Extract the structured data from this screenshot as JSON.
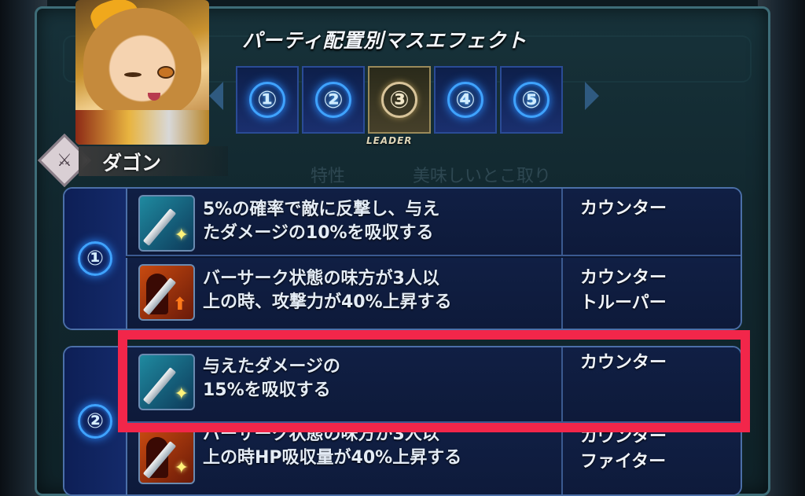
{
  "panel": {
    "title": "パーティ配置別マスエフェクト"
  },
  "tabs": [
    {
      "label": "①",
      "active": false
    },
    {
      "label": "②",
      "active": false
    },
    {
      "label": "③",
      "active": true
    },
    {
      "label": "④",
      "active": false
    },
    {
      "label": "⑤",
      "active": false
    }
  ],
  "leader_label": "LEADER",
  "character": {
    "name": "ダゴン",
    "weapon_icon": "sword-icon"
  },
  "background_text": {
    "left": "特性",
    "right": "美味しいとこ取り"
  },
  "groups": [
    {
      "number": "①",
      "rows": [
        {
          "icon": "counter-sword-icon",
          "description": "5%の確率で敵に反撃し、与えたダメージの10%を吸収する",
          "description_line1": "5%の確率で敵に反撃し、与え",
          "description_line2": "たダメージの10%を吸収する",
          "tag": "カウンター"
        },
        {
          "icon": "berserk-attack-up-icon",
          "description_line1": "バーサーク状態の味方が3人以",
          "description_line2": "上の時、攻撃力が40%上昇する",
          "tag": "カウンター\nトルーパー"
        }
      ]
    },
    {
      "number": "②",
      "rows": [
        {
          "icon": "counter-sword-icon",
          "description_line1": "与えたダメージの",
          "description_line2": "15%を吸収する",
          "tag": "カウンター"
        },
        {
          "icon": "berserk-drain-up-icon",
          "description_line1": "バーサーク状態の味方が3人以",
          "description_line2": "上の時HP吸収量が40%上昇する",
          "tag": "カウンター\nファイター"
        }
      ]
    }
  ],
  "colors": {
    "highlight": "#f2264a",
    "accent_blue": "#3fa3ff",
    "panel_border": "#3e6d78"
  }
}
